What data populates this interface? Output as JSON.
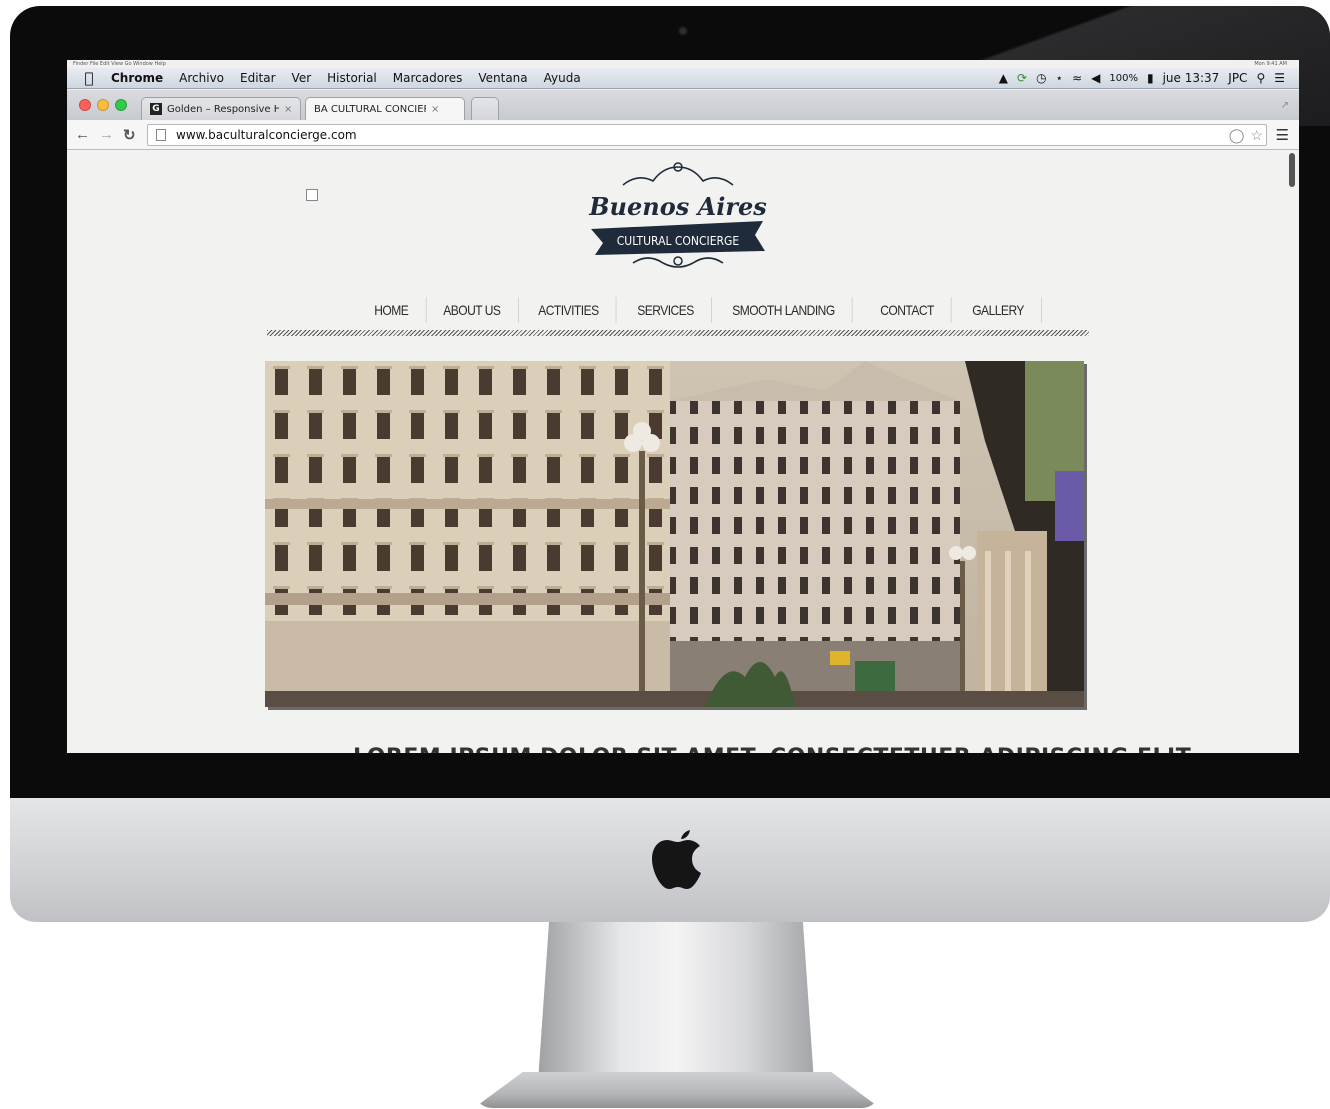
{
  "menubar": {
    "ghost_left": "Finder File Edit View Go Window Help",
    "ghost_right": "Mon 9:41 AM",
    "app": "Chrome",
    "items": [
      "Archivo",
      "Editar",
      "Ver",
      "Historial",
      "Marcadores",
      "Ventana",
      "Ayuda"
    ],
    "battery": "100%",
    "clock": "jue 13:37",
    "user": "JPC"
  },
  "tabs": [
    {
      "favicon": "G",
      "title": "Golden – Responsive HTML",
      "active": false
    },
    {
      "favicon": "",
      "title": "BA CULTURAL CONCIERGE",
      "active": true
    }
  ],
  "address": {
    "url": "www.baculturalconcierge.com"
  },
  "site": {
    "logo_top": "Buenos Aires",
    "logo_banner": "CULTURAL CONCIERGE",
    "nav": [
      "HOME",
      "ABOUT US",
      "ACTIVITIES",
      "SERVICES",
      "SMOOTH LANDING",
      "CONTACT",
      "GALLERY"
    ],
    "heading": "LOREM IPSUM DOLOR SIT AMET, CONSECTETUER ADIPISCING ELIT"
  },
  "colors": {
    "page_bg": "#f2f2f1",
    "nav_text": "#2a2a2a",
    "logo_navy": "#1f2b3b"
  }
}
